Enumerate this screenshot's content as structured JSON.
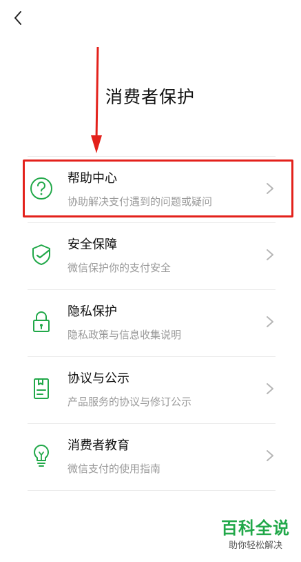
{
  "header": {
    "back_icon": "chevron-left-icon"
  },
  "page_title": "消费者保护",
  "colors": {
    "accent": "#21a849",
    "annotation": "#e3211b",
    "subtitle": "#9a9a9a"
  },
  "items": [
    {
      "title": "帮助中心",
      "subtitle": "协助解决支付遇到的问题或疑问",
      "icon": "question-circle-icon"
    },
    {
      "title": "安全保障",
      "subtitle": "微信保护你的支付安全",
      "icon": "shield-check-icon"
    },
    {
      "title": "隐私保护",
      "subtitle": "隐私政策与信息收集说明",
      "icon": "lock-icon"
    },
    {
      "title": "协议与公示",
      "subtitle": "产品服务的协议与修订公示",
      "icon": "document-icon"
    },
    {
      "title": "消费者教育",
      "subtitle": "微信支付的使用指南",
      "icon": "lightbulb-icon"
    }
  ],
  "watermark": {
    "title": "百科全说",
    "subtitle": "助你轻松解决"
  }
}
